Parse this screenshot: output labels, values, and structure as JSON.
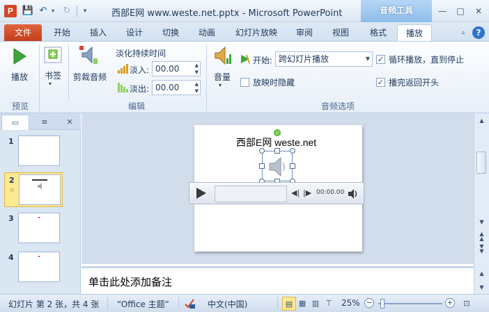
{
  "window": {
    "title": "西部E网 www.weste.net.pptx - Microsoft PowerPoint",
    "context_tab": "音频工具",
    "app_icon": "P"
  },
  "tabs": [
    "文件",
    "开始",
    "插入",
    "设计",
    "切换",
    "动画",
    "幻灯片放映",
    "审阅",
    "视图",
    "格式",
    "播放"
  ],
  "active_tab": "播放",
  "ribbon": {
    "preview": {
      "play_label": "播放",
      "group_label": "预览"
    },
    "edit": {
      "bookmark_label": "书签",
      "trim_label": "剪裁音频",
      "fade_title": "淡化持续时间",
      "fade_in_label": "淡入:",
      "fade_in_value": "00.00",
      "fade_out_label": "淡出:",
      "fade_out_value": "00.00",
      "group_label": "编辑"
    },
    "audio_options": {
      "volume_label": "音量",
      "start_label": "开始:",
      "start_value": "跨幻灯片播放",
      "hide_label": "放映时隐藏",
      "hide_checked": false,
      "loop_label": "循环播放，直到停止",
      "loop_checked": true,
      "rewind_label": "播完返回开头",
      "rewind_checked": true,
      "group_label": "音频选项"
    }
  },
  "slides_panel": {
    "thumbnails": [
      {
        "num": "1"
      },
      {
        "num": "2",
        "star": "☆",
        "selected": true
      },
      {
        "num": "3"
      },
      {
        "num": "4"
      }
    ]
  },
  "slide": {
    "title": "西部E网 weste.net",
    "player_time": "00:00.00"
  },
  "notes": {
    "placeholder": "单击此处添加备注"
  },
  "status": {
    "slide_info": "幻灯片 第 2 张，共 4 张",
    "theme": "“Office 主题”",
    "language": "中文(中国)",
    "zoom": "25%"
  },
  "colors": {
    "accent": "#2b579a",
    "file_tab": "#d24726",
    "context_tab": "#8ebde9",
    "selected_thumb": "#fde98f"
  }
}
